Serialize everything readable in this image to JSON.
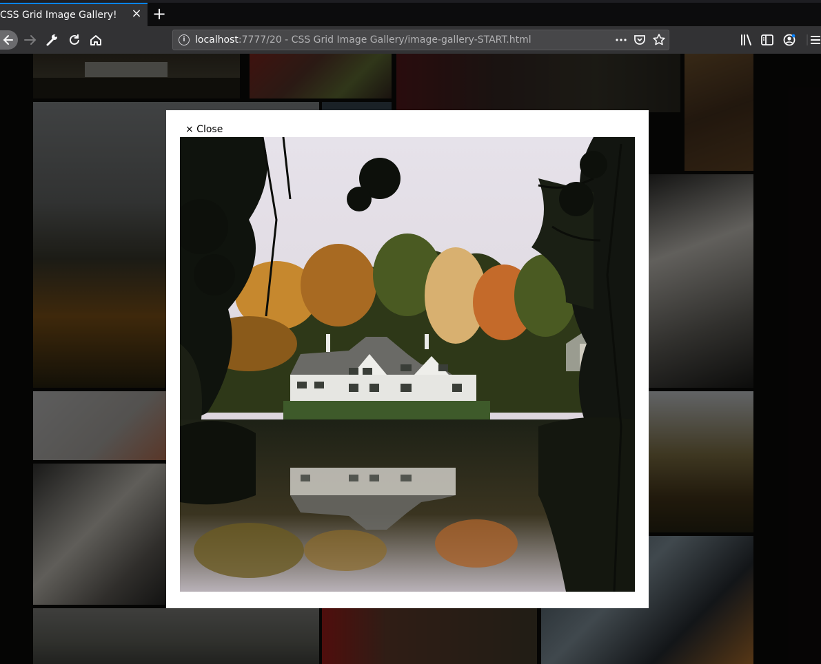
{
  "browser": {
    "tab_title": "CSS Grid Image Gallery!",
    "tab_close": "×",
    "new_tab": "+",
    "url_host": "localhost",
    "url_rest": ":7777/20 - CSS Grid Image Gallery/image-gallery-START.html",
    "icons": [
      "back-arrow-icon",
      "forward-arrow-icon",
      "wrench-icon",
      "reload-icon",
      "home-icon",
      "site-info-icon",
      "page-actions-icon",
      "pocket-icon",
      "bookmark-star-icon",
      "library-icon",
      "sidebar-icon",
      "account-icon",
      "menu-icon"
    ]
  },
  "modal": {
    "close_label": "× Close",
    "image_subject": "white house by lake with autumn trees"
  },
  "colors": {
    "chrome_dark": "#0c0c0d",
    "toolbar": "#323234",
    "urlbar": "#474749",
    "tab_accent": "#0a84ff",
    "modal_bg": "#ffffff"
  }
}
